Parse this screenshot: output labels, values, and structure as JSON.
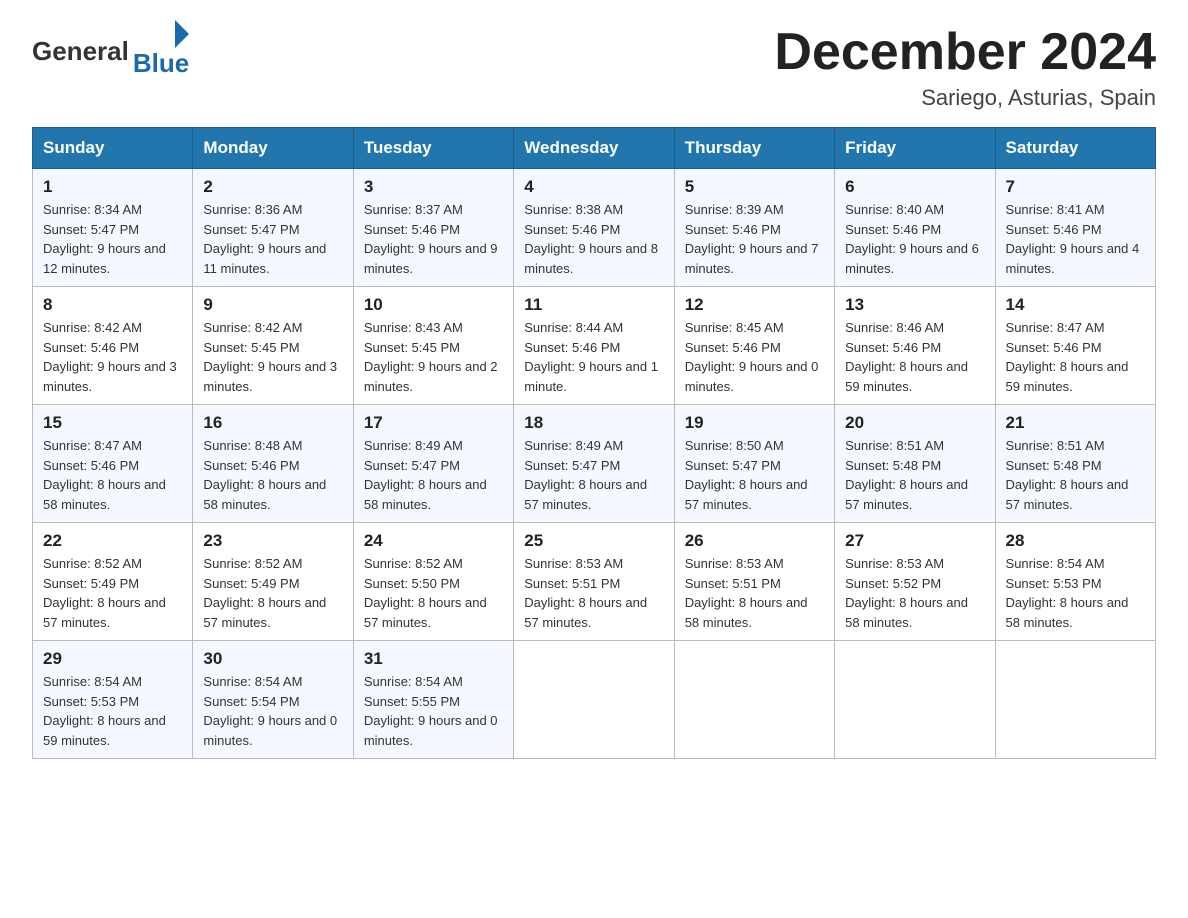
{
  "header": {
    "logo": {
      "general": "General",
      "blue": "Blue"
    },
    "title": "December 2024",
    "location": "Sariego, Asturias, Spain"
  },
  "calendar": {
    "days_of_week": [
      "Sunday",
      "Monday",
      "Tuesday",
      "Wednesday",
      "Thursday",
      "Friday",
      "Saturday"
    ],
    "weeks": [
      [
        {
          "day": "1",
          "sunrise": "8:34 AM",
          "sunset": "5:47 PM",
          "daylight": "9 hours and 12 minutes."
        },
        {
          "day": "2",
          "sunrise": "8:36 AM",
          "sunset": "5:47 PM",
          "daylight": "9 hours and 11 minutes."
        },
        {
          "day": "3",
          "sunrise": "8:37 AM",
          "sunset": "5:46 PM",
          "daylight": "9 hours and 9 minutes."
        },
        {
          "day": "4",
          "sunrise": "8:38 AM",
          "sunset": "5:46 PM",
          "daylight": "9 hours and 8 minutes."
        },
        {
          "day": "5",
          "sunrise": "8:39 AM",
          "sunset": "5:46 PM",
          "daylight": "9 hours and 7 minutes."
        },
        {
          "day": "6",
          "sunrise": "8:40 AM",
          "sunset": "5:46 PM",
          "daylight": "9 hours and 6 minutes."
        },
        {
          "day": "7",
          "sunrise": "8:41 AM",
          "sunset": "5:46 PM",
          "daylight": "9 hours and 4 minutes."
        }
      ],
      [
        {
          "day": "8",
          "sunrise": "8:42 AM",
          "sunset": "5:46 PM",
          "daylight": "9 hours and 3 minutes."
        },
        {
          "day": "9",
          "sunrise": "8:42 AM",
          "sunset": "5:45 PM",
          "daylight": "9 hours and 3 minutes."
        },
        {
          "day": "10",
          "sunrise": "8:43 AM",
          "sunset": "5:45 PM",
          "daylight": "9 hours and 2 minutes."
        },
        {
          "day": "11",
          "sunrise": "8:44 AM",
          "sunset": "5:46 PM",
          "daylight": "9 hours and 1 minute."
        },
        {
          "day": "12",
          "sunrise": "8:45 AM",
          "sunset": "5:46 PM",
          "daylight": "9 hours and 0 minutes."
        },
        {
          "day": "13",
          "sunrise": "8:46 AM",
          "sunset": "5:46 PM",
          "daylight": "8 hours and 59 minutes."
        },
        {
          "day": "14",
          "sunrise": "8:47 AM",
          "sunset": "5:46 PM",
          "daylight": "8 hours and 59 minutes."
        }
      ],
      [
        {
          "day": "15",
          "sunrise": "8:47 AM",
          "sunset": "5:46 PM",
          "daylight": "8 hours and 58 minutes."
        },
        {
          "day": "16",
          "sunrise": "8:48 AM",
          "sunset": "5:46 PM",
          "daylight": "8 hours and 58 minutes."
        },
        {
          "day": "17",
          "sunrise": "8:49 AM",
          "sunset": "5:47 PM",
          "daylight": "8 hours and 58 minutes."
        },
        {
          "day": "18",
          "sunrise": "8:49 AM",
          "sunset": "5:47 PM",
          "daylight": "8 hours and 57 minutes."
        },
        {
          "day": "19",
          "sunrise": "8:50 AM",
          "sunset": "5:47 PM",
          "daylight": "8 hours and 57 minutes."
        },
        {
          "day": "20",
          "sunrise": "8:51 AM",
          "sunset": "5:48 PM",
          "daylight": "8 hours and 57 minutes."
        },
        {
          "day": "21",
          "sunrise": "8:51 AM",
          "sunset": "5:48 PM",
          "daylight": "8 hours and 57 minutes."
        }
      ],
      [
        {
          "day": "22",
          "sunrise": "8:52 AM",
          "sunset": "5:49 PM",
          "daylight": "8 hours and 57 minutes."
        },
        {
          "day": "23",
          "sunrise": "8:52 AM",
          "sunset": "5:49 PM",
          "daylight": "8 hours and 57 minutes."
        },
        {
          "day": "24",
          "sunrise": "8:52 AM",
          "sunset": "5:50 PM",
          "daylight": "8 hours and 57 minutes."
        },
        {
          "day": "25",
          "sunrise": "8:53 AM",
          "sunset": "5:51 PM",
          "daylight": "8 hours and 57 minutes."
        },
        {
          "day": "26",
          "sunrise": "8:53 AM",
          "sunset": "5:51 PM",
          "daylight": "8 hours and 58 minutes."
        },
        {
          "day": "27",
          "sunrise": "8:53 AM",
          "sunset": "5:52 PM",
          "daylight": "8 hours and 58 minutes."
        },
        {
          "day": "28",
          "sunrise": "8:54 AM",
          "sunset": "5:53 PM",
          "daylight": "8 hours and 58 minutes."
        }
      ],
      [
        {
          "day": "29",
          "sunrise": "8:54 AM",
          "sunset": "5:53 PM",
          "daylight": "8 hours and 59 minutes."
        },
        {
          "day": "30",
          "sunrise": "8:54 AM",
          "sunset": "5:54 PM",
          "daylight": "9 hours and 0 minutes."
        },
        {
          "day": "31",
          "sunrise": "8:54 AM",
          "sunset": "5:55 PM",
          "daylight": "9 hours and 0 minutes."
        },
        null,
        null,
        null,
        null
      ]
    ]
  }
}
